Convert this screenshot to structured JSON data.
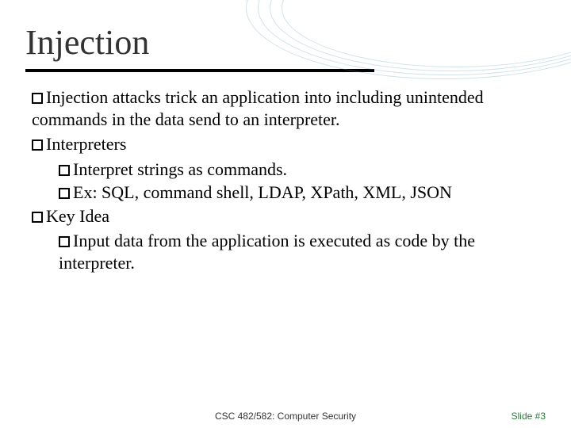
{
  "title": "Injection",
  "bullets": {
    "b1": "Injection attacks trick an application into including unintended commands in the data send to an interpreter.",
    "b2": "Interpreters",
    "b2a": "Interpret strings as commands.",
    "b2b": "Ex: SQL, command shell, LDAP, XPath, XML, JSON",
    "b3": "Key Idea",
    "b3a": "Input data from the application is executed as code by the interpreter."
  },
  "footer": {
    "center": "CSC 482/582: Computer Security",
    "right": "Slide #3"
  }
}
